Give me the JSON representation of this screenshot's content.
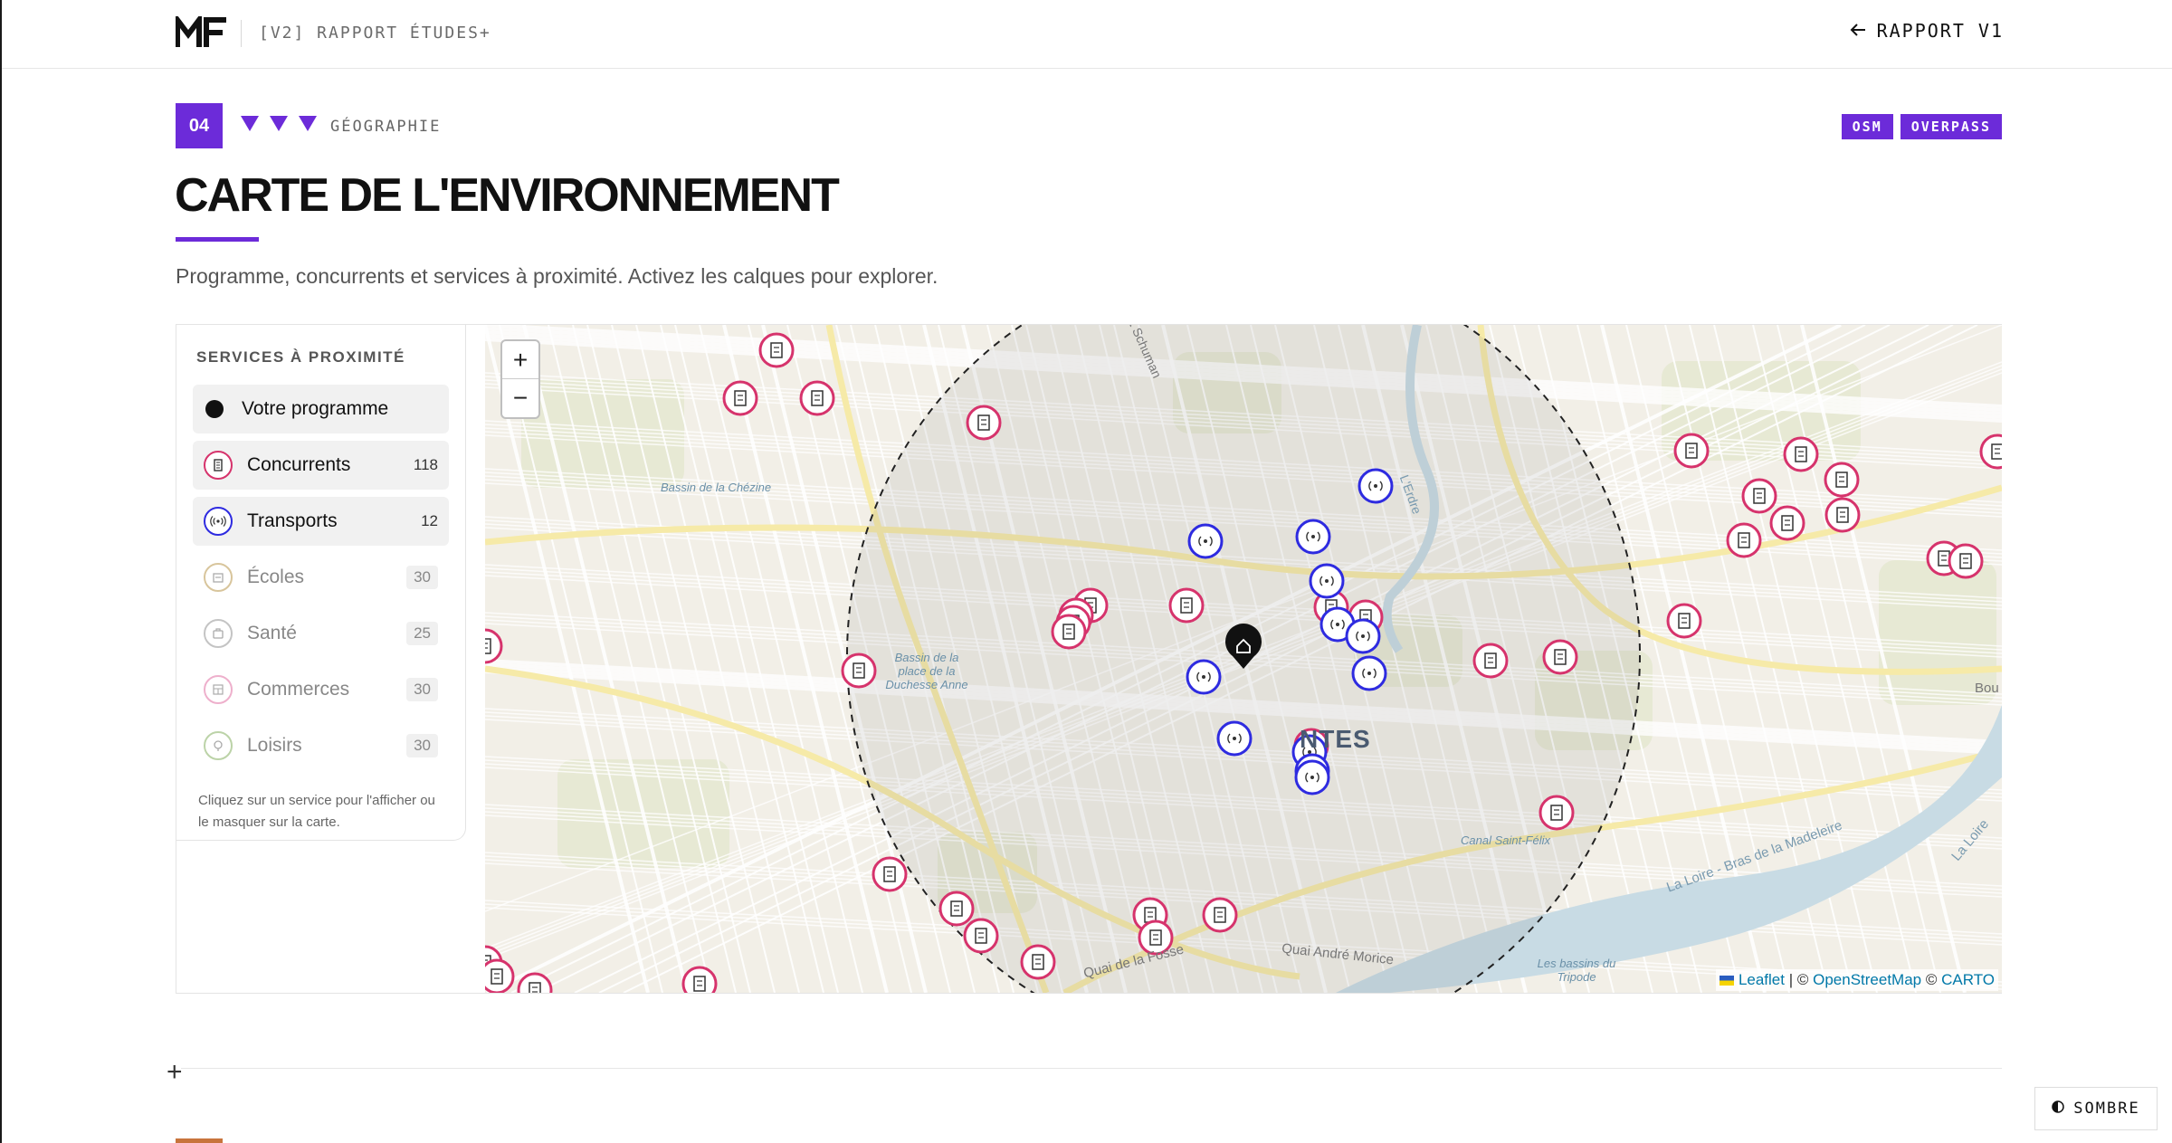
{
  "header": {
    "logo_text": "MF",
    "crumb": "[V2] RAPPORT ÉTUDES+",
    "back_label": "RAPPORT V1"
  },
  "section": {
    "number": "04",
    "label": "GÉOGRAPHIE",
    "tags": [
      "OSM",
      "OVERPASS"
    ],
    "title": "CARTE DE L'ENVIRONNEMENT",
    "subtitle": "Programme, concurrents et services à proximité. Activez les calques pour explorer."
  },
  "panel": {
    "title": "SERVICES À PROXIMITÉ",
    "program_label": "Votre programme",
    "layers": [
      {
        "label": "Concurrents",
        "count": "118",
        "color": "#d6336c",
        "icon": "building-icon"
      },
      {
        "label": "Transports",
        "count": "12",
        "color": "#2e2be0",
        "icon": "broadcast-icon"
      },
      {
        "label": "Écoles",
        "count": "30",
        "color": "#c9a45c",
        "icon": "school-icon"
      },
      {
        "label": "Santé",
        "count": "25",
        "color": "#8a8a8a",
        "icon": "health-icon"
      },
      {
        "label": "Commerces",
        "count": "30",
        "color": "#e06aa0",
        "icon": "shop-icon"
      },
      {
        "label": "Loisirs",
        "count": "30",
        "color": "#7aa05a",
        "icon": "leisure-icon"
      }
    ],
    "hint": "Cliquez sur un service pour l'afficher ou le masquer sur la carte."
  },
  "map": {
    "zoom_in": "+",
    "zoom_out": "−",
    "city_label": "NTES",
    "places": [
      "Bassin de la Chézine",
      "Bassin de la place de la Duchesse Anne",
      "Canal Saint-Félix",
      "Les bassins du Tripode",
      "Quai André Morice",
      "Quai de la Fosse",
      "La Loire - Bras de la Madeleire",
      "La Loire",
      "L'Erdre",
      "Bou",
      "t Schuman"
    ],
    "attribution": {
      "leaflet": "Leaflet",
      "sep1": " | © ",
      "osm": "OpenStreetMap",
      "sep2": " © ",
      "carto": "CARTO"
    }
  },
  "footer": {
    "theme_label": "SOMBRE"
  },
  "colors": {
    "accent": "#6c2bd9",
    "competitor": "#d6336c",
    "transport": "#2e2be0",
    "next_section": "#c8743c"
  }
}
